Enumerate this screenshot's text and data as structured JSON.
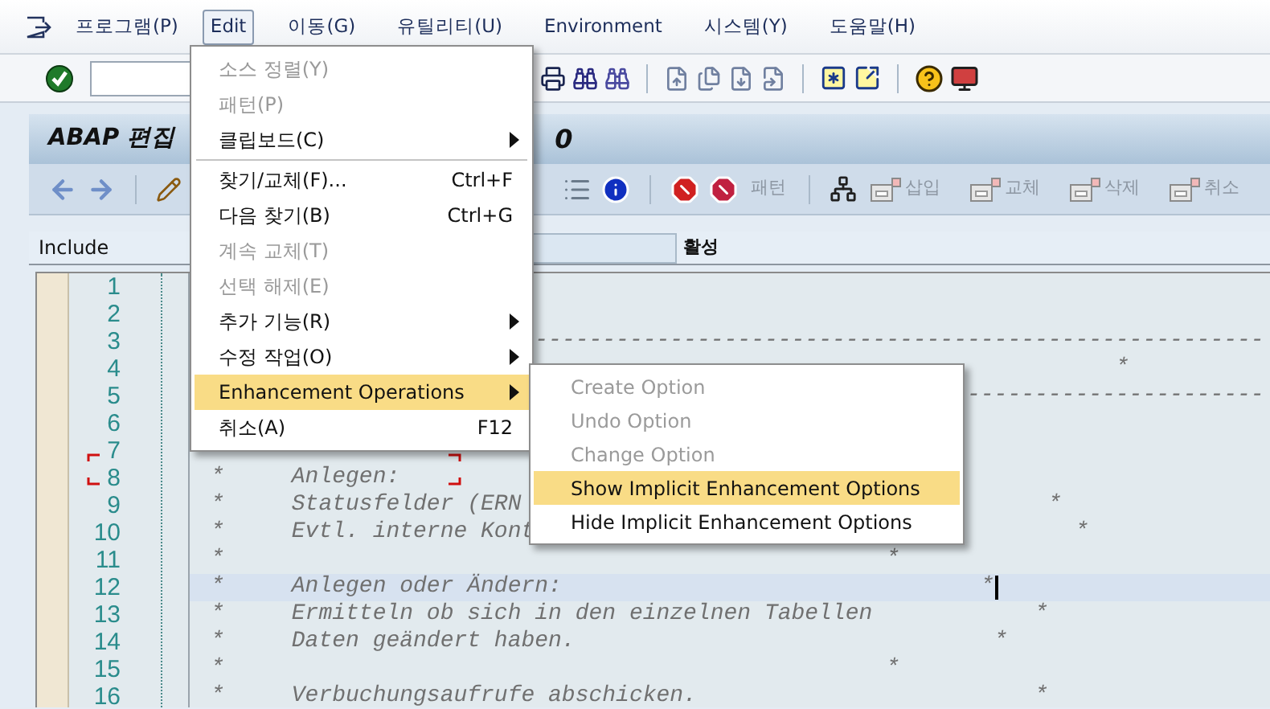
{
  "menubar": [
    {
      "label": "프로그램(P)",
      "selected": false
    },
    {
      "label": "Edit",
      "selected": true
    },
    {
      "label": "이동(G)",
      "selected": false
    },
    {
      "label": "유틸리티(U)",
      "selected": false
    },
    {
      "label": "Environment",
      "selected": false
    },
    {
      "label": "시스템(Y)",
      "selected": false
    },
    {
      "label": "도움말(H)",
      "selected": false
    }
  ],
  "title": {
    "text": "ABAP 편집",
    "tail": "0"
  },
  "app_toolbar": {
    "buttons": [
      {
        "label": "패턴",
        "disabled": true
      },
      {
        "label": "삽입",
        "disabled": true
      },
      {
        "label": "교체",
        "disabled": true
      },
      {
        "label": "삭제",
        "disabled": true
      },
      {
        "label": "취소",
        "disabled": true
      }
    ]
  },
  "include": {
    "label": "Include",
    "status": "활성"
  },
  "editor": {
    "lines": [
      {
        "number": "1"
      },
      {
        "number": "2"
      },
      {
        "number": "3",
        "segments": [
          "                        ------------------------------------------------------"
        ]
      },
      {
        "number": "4",
        "segments": [
          "                                                                   *"
        ]
      },
      {
        "number": "5",
        "segments": [
          "                                                        ----------------------"
        ]
      },
      {
        "number": "6"
      },
      {
        "number": "7"
      },
      {
        "number": "8",
        "segments": [
          "*     Anlegen:"
        ]
      },
      {
        "number": "9",
        "segments": [
          "*     Statusfelder (ERN",
          "                                       *"
        ]
      },
      {
        "number": "10",
        "segments": [
          "*     Evtl. interne Kont",
          "                                        *"
        ]
      },
      {
        "number": "11",
        "segments": [
          "*",
          "                                                 *"
        ]
      },
      {
        "number": "12",
        "current": true,
        "cursor": true,
        "segments": [
          "*     Anlegen oder Ändern:",
          "                               *"
        ]
      },
      {
        "number": "13",
        "segments": [
          "*     Ermitteln ob sich in den einzelnen Tabellen",
          "            *"
        ]
      },
      {
        "number": "14",
        "segments": [
          "*     Daten geändert haben.",
          "                               *"
        ]
      },
      {
        "number": "15",
        "segments": [
          "*",
          "                                                 *"
        ]
      },
      {
        "number": "16",
        "segments": [
          "*     Verbuchungsaufrufe abschicken.",
          "                         *"
        ]
      }
    ]
  },
  "edit_menu": {
    "items": [
      {
        "kind": "item",
        "label": "소스 정렬(Y)",
        "disabled": true,
        "submenu": false,
        "selected": false
      },
      {
        "kind": "item",
        "label": "패턴(P)",
        "disabled": true,
        "submenu": false,
        "selected": false
      },
      {
        "kind": "item",
        "label": "클립보드(C)",
        "disabled": false,
        "submenu": true,
        "selected": false
      },
      {
        "kind": "separator"
      },
      {
        "kind": "item",
        "label": "찾기/교체(F)...",
        "shortcut": "Ctrl+F",
        "disabled": false,
        "submenu": false,
        "selected": false
      },
      {
        "kind": "item",
        "label": "다음 찾기(B)",
        "shortcut": "Ctrl+G",
        "disabled": false,
        "submenu": false,
        "selected": false
      },
      {
        "kind": "item",
        "label": "계속 교체(T)",
        "disabled": true,
        "submenu": false,
        "selected": false
      },
      {
        "kind": "item",
        "label": "선택 해제(E)",
        "disabled": true,
        "submenu": false,
        "selected": false
      },
      {
        "kind": "item",
        "label": "추가 기능(R)",
        "disabled": false,
        "submenu": true,
        "selected": false
      },
      {
        "kind": "item",
        "label": "수정 작업(O)",
        "disabled": false,
        "submenu": true,
        "selected": false
      },
      {
        "kind": "item",
        "label": "Enhancement Operations",
        "disabled": false,
        "submenu": true,
        "selected": true
      },
      {
        "kind": "item",
        "label": "취소(A)",
        "shortcut": "F12",
        "disabled": false,
        "submenu": false,
        "selected": false
      }
    ]
  },
  "submenu": {
    "items": [
      {
        "label": "Create Option",
        "disabled": true,
        "selected": false
      },
      {
        "label": "Undo Option",
        "disabled": true,
        "selected": false
      },
      {
        "label": "Change Option",
        "disabled": true,
        "selected": false
      },
      {
        "label": "Show Implicit Enhancement Options",
        "disabled": false,
        "selected": true
      },
      {
        "label": "Hide Implicit Enhancement Options",
        "disabled": false,
        "selected": false
      }
    ]
  }
}
